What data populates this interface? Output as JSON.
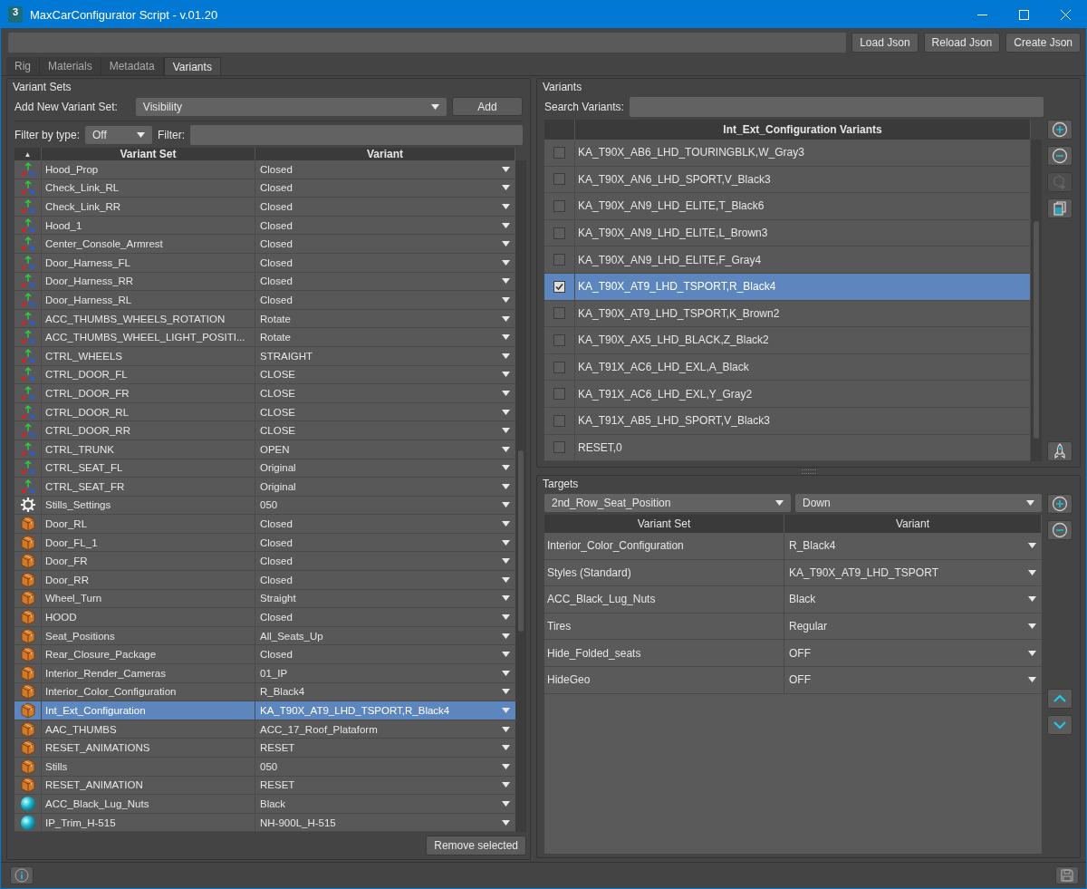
{
  "window": {
    "title": "MaxCarConfigurator Script - v.01.20",
    "logo_text": "3"
  },
  "toolbar": {
    "buttons": [
      "Load Json",
      "Reload Json",
      "Create Json"
    ]
  },
  "tabs": [
    {
      "label": "Rig",
      "selected": false
    },
    {
      "label": "Materials",
      "selected": false
    },
    {
      "label": "Metadata",
      "selected": false
    },
    {
      "label": "Variants",
      "selected": true
    }
  ],
  "variant_sets": {
    "title": "Variant Sets",
    "add_label": "Add New Variant Set:",
    "add_type": "Visibility",
    "add_button": "Add",
    "filter_type_label": "Filter by type:",
    "filter_type": "Off",
    "filter_label": "Filter:",
    "sort_mark": "▲",
    "columns": [
      "Variant Set",
      "Variant"
    ],
    "rows": [
      {
        "kind": "axes",
        "name": "Hood_Prop",
        "variant": "Closed",
        "selected": false
      },
      {
        "kind": "axes",
        "name": "Check_Link_RL",
        "variant": "Closed",
        "selected": false
      },
      {
        "kind": "axes",
        "name": "Check_Link_RR",
        "variant": "Closed",
        "selected": false
      },
      {
        "kind": "axes",
        "name": "Hood_1",
        "variant": "Closed",
        "selected": false
      },
      {
        "kind": "axes",
        "name": "Center_Console_Armrest",
        "variant": "Closed",
        "selected": false
      },
      {
        "kind": "axes",
        "name": "Door_Harness_FL",
        "variant": "Closed",
        "selected": false
      },
      {
        "kind": "axes",
        "name": "Door_Harness_RR",
        "variant": "Closed",
        "selected": false
      },
      {
        "kind": "axes",
        "name": "Door_Harness_RL",
        "variant": "Closed",
        "selected": false
      },
      {
        "kind": "axes",
        "name": "ACC_THUMBS_WHEELS_ROTATION",
        "variant": "Rotate",
        "selected": false
      },
      {
        "kind": "axes",
        "name": "ACC_THUMBS_WHEEL_LIGHT_POSITI...",
        "variant": "Rotate",
        "selected": false
      },
      {
        "kind": "axes",
        "name": "CTRL_WHEELS",
        "variant": "STRAIGHT",
        "selected": false
      },
      {
        "kind": "axes",
        "name": "CTRL_DOOR_FL",
        "variant": "CLOSE",
        "selected": false
      },
      {
        "kind": "axes",
        "name": "CTRL_DOOR_FR",
        "variant": "CLOSE",
        "selected": false
      },
      {
        "kind": "axes",
        "name": "CTRL_DOOR_RL",
        "variant": "CLOSE",
        "selected": false
      },
      {
        "kind": "axes",
        "name": "CTRL_DOOR_RR",
        "variant": "CLOSE",
        "selected": false
      },
      {
        "kind": "axes",
        "name": "CTRL_TRUNK",
        "variant": "OPEN",
        "selected": false
      },
      {
        "kind": "axes",
        "name": "CTRL_SEAT_FL",
        "variant": "Original",
        "selected": false
      },
      {
        "kind": "axes",
        "name": "CTRL_SEAT_FR",
        "variant": "Original",
        "selected": false
      },
      {
        "kind": "gear",
        "name": "Stills_Settings",
        "variant": "050",
        "selected": false
      },
      {
        "kind": "box",
        "name": "Door_RL",
        "variant": "Closed",
        "selected": false
      },
      {
        "kind": "box",
        "name": "Door_FL_1",
        "variant": "Closed",
        "selected": false
      },
      {
        "kind": "box",
        "name": "Door_FR",
        "variant": "Closed",
        "selected": false
      },
      {
        "kind": "box",
        "name": "Door_RR",
        "variant": "Closed",
        "selected": false
      },
      {
        "kind": "box",
        "name": "Wheel_Turn",
        "variant": "Straight",
        "selected": false
      },
      {
        "kind": "box",
        "name": "HOOD",
        "variant": "Closed",
        "selected": false
      },
      {
        "kind": "box",
        "name": "Seat_Positions",
        "variant": "All_Seats_Up",
        "selected": false
      },
      {
        "kind": "box",
        "name": "Rear_Closure_Package",
        "variant": "Closed",
        "selected": false
      },
      {
        "kind": "box",
        "name": "Interior_Render_Cameras",
        "variant": "01_IP",
        "selected": false
      },
      {
        "kind": "box",
        "name": "Interior_Color_Configuration",
        "variant": "R_Black4",
        "selected": false
      },
      {
        "kind": "box",
        "name": "Int_Ext_Configuration",
        "variant": "KA_T90X_AT9_LHD_TSPORT,R_Black4",
        "selected": true
      },
      {
        "kind": "box",
        "name": "AAC_THUMBS",
        "variant": "ACC_17_Roof_Plataform",
        "selected": false
      },
      {
        "kind": "box",
        "name": "RESET_ANIMATIONS",
        "variant": "RESET",
        "selected": false
      },
      {
        "kind": "box",
        "name": "Stills",
        "variant": "050",
        "selected": false
      },
      {
        "kind": "box",
        "name": "RESET_ANIMATION",
        "variant": "RESET",
        "selected": false
      },
      {
        "kind": "sphere",
        "name": "ACC_Black_Lug_Nuts",
        "variant": "Black",
        "selected": false
      },
      {
        "kind": "sphere",
        "name": "IP_Trim_H-515",
        "variant": "NH-900L_H-515",
        "selected": false
      }
    ],
    "remove_button": "Remove selected"
  },
  "variants": {
    "title": "Variants",
    "search_label": "Search Variants:",
    "column": "Int_Ext_Configuration Variants",
    "items": [
      {
        "label": "KA_T90X_AB6_LHD_TOURINGBLK,W_Gray3",
        "checked": false,
        "selected": false
      },
      {
        "label": "KA_T90X_AN6_LHD_SPORT,V_Black3",
        "checked": false,
        "selected": false
      },
      {
        "label": "KA_T90X_AN9_LHD_ELITE,T_Black6",
        "checked": false,
        "selected": false
      },
      {
        "label": "KA_T90X_AN9_LHD_ELITE,L_Brown3",
        "checked": false,
        "selected": false
      },
      {
        "label": "KA_T90X_AN9_LHD_ELITE,F_Gray4",
        "checked": false,
        "selected": false
      },
      {
        "label": "KA_T90X_AT9_LHD_TSPORT,R_Black4",
        "checked": true,
        "selected": true
      },
      {
        "label": "KA_T90X_AT9_LHD_TSPORT,K_Brown2",
        "checked": false,
        "selected": false
      },
      {
        "label": "KA_T90X_AX5_LHD_BLACK,Z_Black2",
        "checked": false,
        "selected": false
      },
      {
        "label": "KA_T91X_AC6_LHD_EXL,A_Black",
        "checked": false,
        "selected": false
      },
      {
        "label": "KA_T91X_AC6_LHD_EXL,Y_Gray2",
        "checked": false,
        "selected": false
      },
      {
        "label": "KA_T91X_AB5_LHD_SPORT,V_Black3",
        "checked": false,
        "selected": false
      },
      {
        "label": "RESET,0",
        "checked": false,
        "selected": false
      }
    ]
  },
  "targets": {
    "title": "Targets",
    "set_select": "2nd_Row_Seat_Position",
    "variant_select": "Down",
    "columns": [
      "Variant Set",
      "Variant"
    ],
    "rows": [
      {
        "set": "Interior_Color_Configuration",
        "variant": "R_Black4"
      },
      {
        "set": "Styles (Standard)",
        "variant": "KA_T90X_AT9_LHD_TSPORT"
      },
      {
        "set": "ACC_Black_Lug_Nuts",
        "variant": "Black"
      },
      {
        "set": "Tires",
        "variant": "Regular"
      },
      {
        "set": "Hide_Folded_seats",
        "variant": "OFF"
      },
      {
        "set": "HideGeo",
        "variant": "OFF"
      }
    ]
  }
}
